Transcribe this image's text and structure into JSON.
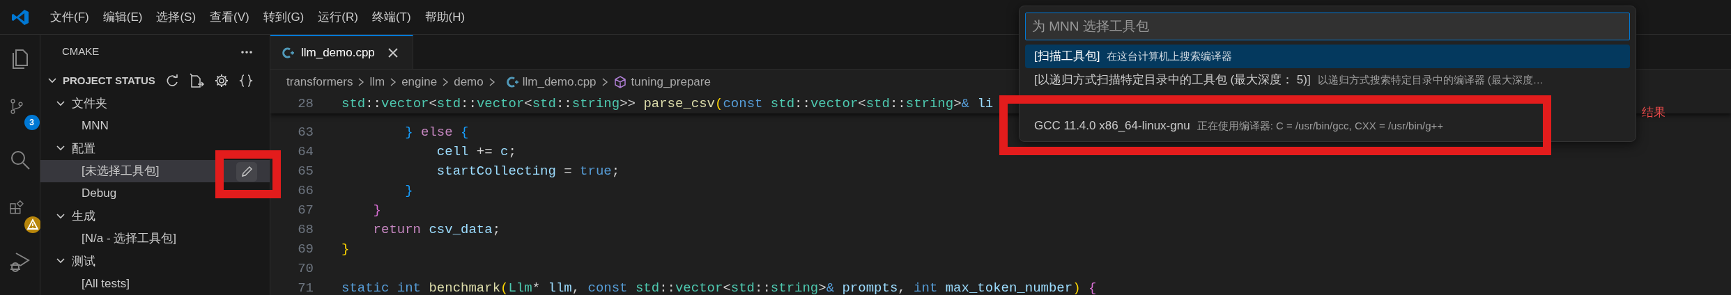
{
  "menu": [
    "文件(F)",
    "编辑(E)",
    "选择(S)",
    "查看(V)",
    "转到(G)",
    "运行(R)",
    "终端(T)",
    "帮助(H)"
  ],
  "activity_bar": [
    {
      "kind": "files"
    },
    {
      "kind": "source-control",
      "badge": "3"
    },
    {
      "kind": "search"
    },
    {
      "kind": "extensions",
      "warning": true
    },
    {
      "kind": "debug"
    }
  ],
  "sidebar": {
    "title": "CMAKE",
    "section": {
      "title": "PROJECT STATUS",
      "expanded": true
    },
    "tree": [
      {
        "label": "文件夹",
        "expanded": true,
        "children": [
          {
            "label": "MNN",
            "selected": false
          }
        ]
      },
      {
        "label": "配置",
        "expanded": true,
        "children": [
          {
            "label": "[未选择工具包]",
            "selected": true
          },
          {
            "label": "Debug",
            "selected": false
          }
        ]
      },
      {
        "label": "生成",
        "expanded": true,
        "children": [
          {
            "label": "[N/a - 选择工具包]",
            "selected": false
          }
        ]
      },
      {
        "label": "测试",
        "expanded": true,
        "children": [
          {
            "label": "[All tests]",
            "selected": false
          }
        ]
      }
    ]
  },
  "editor": {
    "tab": {
      "label": "llm_demo.cpp",
      "selected": true
    },
    "breadcrumb": [
      {
        "label": "transformers",
        "kind": "folder"
      },
      {
        "label": "llm",
        "kind": "folder"
      },
      {
        "label": "engine",
        "kind": "folder"
      },
      {
        "label": "demo",
        "kind": "folder"
      },
      {
        "label": "llm_demo.cpp",
        "kind": "file"
      },
      {
        "label": "tuning_prepare",
        "kind": "symbol"
      }
    ],
    "sticky_line": {
      "number": "28",
      "tokens": [
        {
          "text": "std",
          "kind": "type"
        },
        {
          "text": "::",
          "kind": "plain"
        },
        {
          "text": "vector",
          "kind": "type"
        },
        {
          "text": "<",
          "kind": "plain"
        },
        {
          "text": "std",
          "kind": "type"
        },
        {
          "text": "::",
          "kind": "plain"
        },
        {
          "text": "vector",
          "kind": "type"
        },
        {
          "text": "<",
          "kind": "plain"
        },
        {
          "text": "std",
          "kind": "type"
        },
        {
          "text": "::",
          "kind": "plain"
        },
        {
          "text": "string",
          "kind": "type"
        },
        {
          "text": ">> ",
          "kind": "plain"
        },
        {
          "text": "parse_csv",
          "kind": "func"
        },
        {
          "text": "(",
          "kind": "b1"
        },
        {
          "text": "const ",
          "kind": "kw"
        },
        {
          "text": "std",
          "kind": "type"
        },
        {
          "text": "::",
          "kind": "plain"
        },
        {
          "text": "vector",
          "kind": "type"
        },
        {
          "text": "<",
          "kind": "plain"
        },
        {
          "text": "std",
          "kind": "type"
        },
        {
          "text": "::",
          "kind": "plain"
        },
        {
          "text": "string",
          "kind": "type"
        },
        {
          "text": ">",
          "kind": "plain"
        },
        {
          "text": "& ",
          "kind": "kw"
        },
        {
          "text": "li",
          "kind": "var"
        }
      ]
    },
    "lines": [
      {
        "number": "63",
        "tokens": [
          {
            "text": "        }",
            "kind": "b3"
          },
          {
            "text": " else ",
            "kind": "ctl"
          },
          {
            "text": "{",
            "kind": "b3"
          }
        ]
      },
      {
        "number": "64",
        "tokens": [
          {
            "text": "            cell",
            "kind": "var"
          },
          {
            "text": " += ",
            "kind": "plain"
          },
          {
            "text": "c",
            "kind": "var"
          },
          {
            "text": ";",
            "kind": "plain"
          }
        ]
      },
      {
        "number": "65",
        "tokens": [
          {
            "text": "            startCollecting",
            "kind": "var"
          },
          {
            "text": " = ",
            "kind": "plain"
          },
          {
            "text": "true",
            "kind": "kw"
          },
          {
            "text": ";",
            "kind": "plain"
          }
        ]
      },
      {
        "number": "66",
        "tokens": [
          {
            "text": "        }",
            "kind": "b3"
          }
        ]
      },
      {
        "number": "67",
        "tokens": [
          {
            "text": "    }",
            "kind": "b2"
          }
        ]
      },
      {
        "number": "68",
        "tokens": [
          {
            "text": "    return ",
            "kind": "ctl"
          },
          {
            "text": "csv_data",
            "kind": "var"
          },
          {
            "text": ";",
            "kind": "plain"
          }
        ]
      },
      {
        "number": "69",
        "tokens": [
          {
            "text": "}",
            "kind": "b1"
          }
        ]
      },
      {
        "number": "70"
      },
      {
        "number": "71",
        "tokens": [
          {
            "text": "static int ",
            "kind": "kw"
          },
          {
            "text": "benchmark",
            "kind": "func"
          },
          {
            "text": "(",
            "kind": "b1"
          },
          {
            "text": "Llm",
            "kind": "type"
          },
          {
            "text": "* ",
            "kind": "plain"
          },
          {
            "text": "llm",
            "kind": "var"
          },
          {
            "text": ", ",
            "kind": "plain"
          },
          {
            "text": "const ",
            "kind": "kw"
          },
          {
            "text": "std",
            "kind": "type"
          },
          {
            "text": "::",
            "kind": "plain"
          },
          {
            "text": "vector",
            "kind": "type"
          },
          {
            "text": "<",
            "kind": "plain"
          },
          {
            "text": "std",
            "kind": "type"
          },
          {
            "text": "::",
            "kind": "plain"
          },
          {
            "text": "string",
            "kind": "type"
          },
          {
            "text": ">",
            "kind": "plain"
          },
          {
            "text": "& ",
            "kind": "kw"
          },
          {
            "text": "prompts",
            "kind": "var"
          },
          {
            "text": ", ",
            "kind": "plain"
          },
          {
            "text": "int ",
            "kind": "kw"
          },
          {
            "text": "max_token_number",
            "kind": "var"
          },
          {
            "text": ")",
            "kind": "b1"
          },
          {
            "text": " {",
            "kind": "b2"
          }
        ]
      }
    ],
    "diagnostic": "结果"
  },
  "quick_pick": {
    "placeholder": "为 MNN 选择工具包",
    "items": [
      {
        "label": "[扫描工具包]",
        "description": "在这台计算机上搜索编译器",
        "selected": true
      },
      {
        "label": "[以递归方式扫描特定目录中的工具包 (最大深度： 5)]",
        "description": "以递归方式搜索特定目录中的编译器 (最大深度…",
        "selected": false
      },
      {
        "label": "GCC 11.4.0 x86_64-linux-gnu",
        "description": "正在使用编译器: C = /usr/bin/gcc, CXX = /usr/bin/g++",
        "selected": false
      }
    ]
  }
}
